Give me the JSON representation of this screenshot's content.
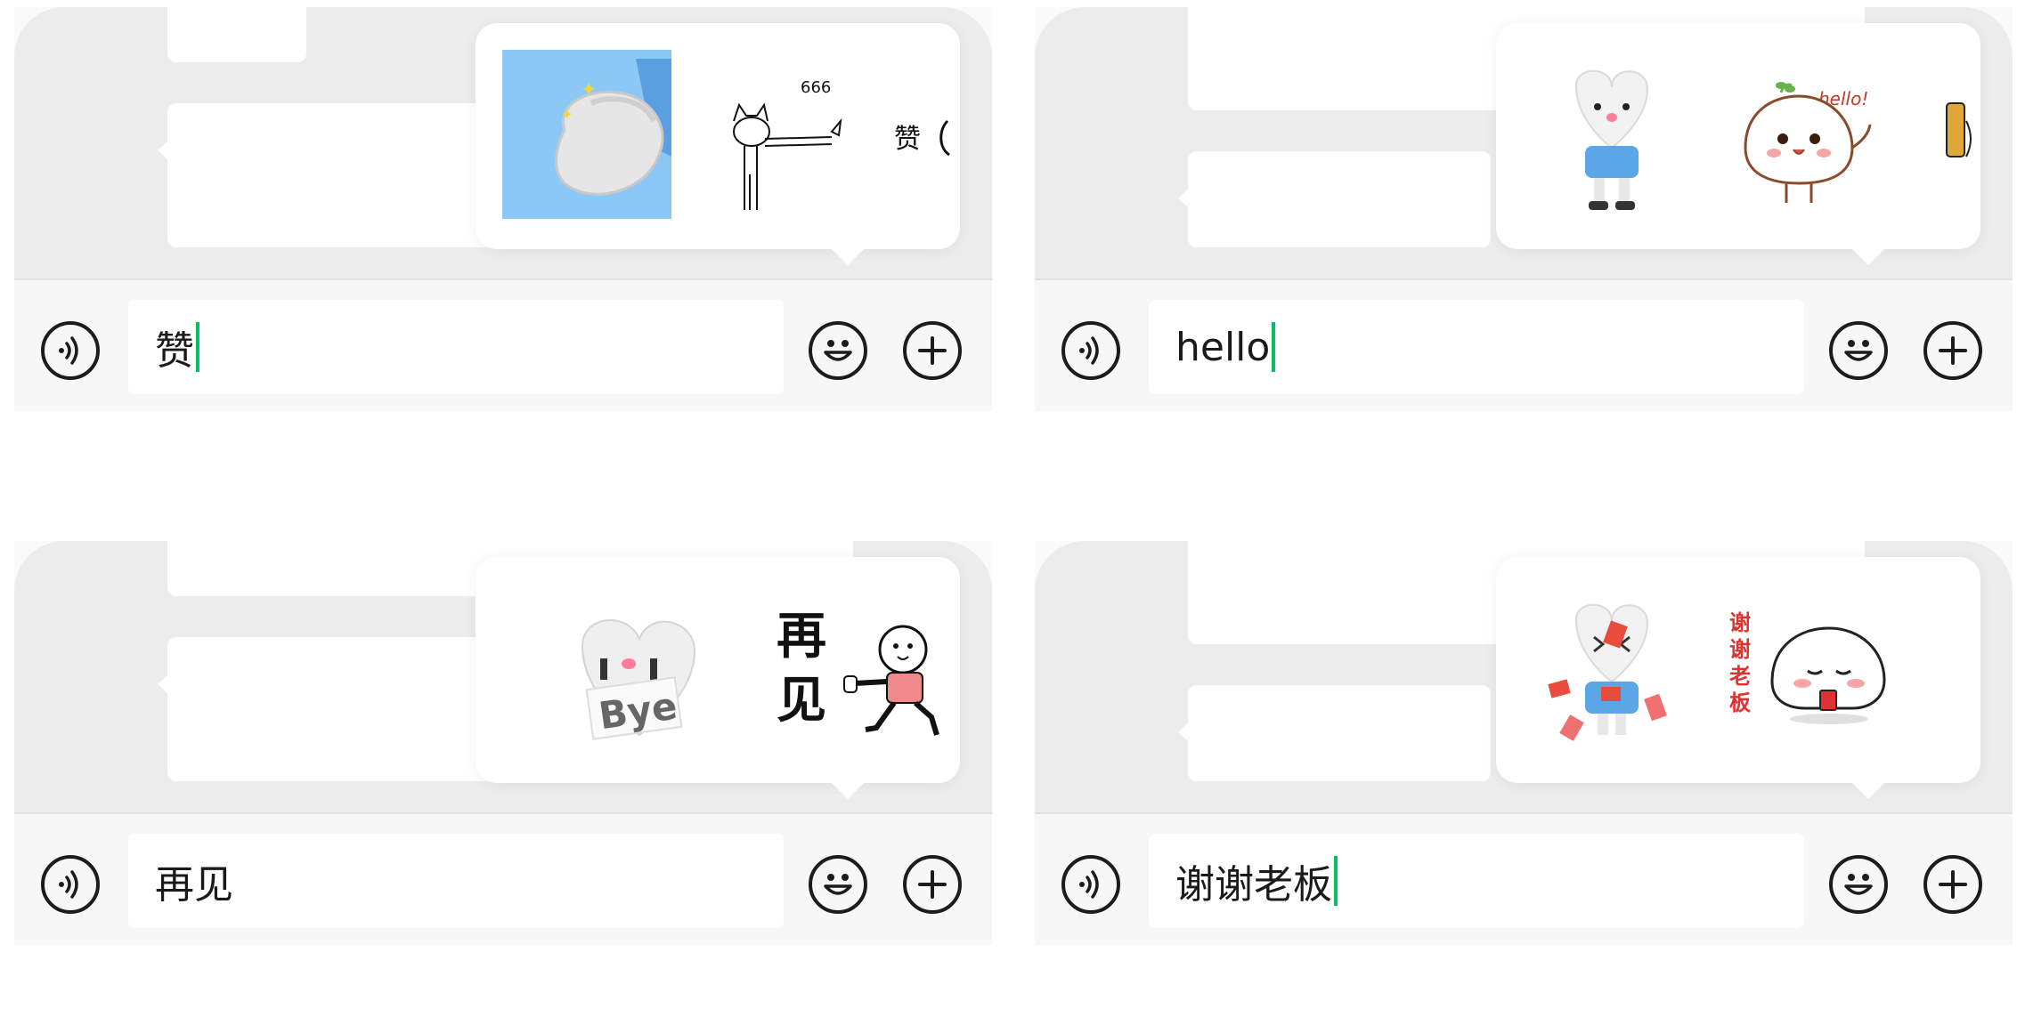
{
  "panels": [
    {
      "id": "top-left",
      "input_text": "赞",
      "show_caret": true,
      "stickers": [
        {
          "kind": "arm-flex",
          "icon": "flexed-arm-sticker"
        },
        {
          "kind": "cat-thumbs-666",
          "icon": "cat-thumb-sticker",
          "text": "666"
        },
        {
          "kind": "partial-zan",
          "icon": "zan-sticker-partial",
          "text": "赞"
        }
      ]
    },
    {
      "id": "top-right",
      "input_text": "hello",
      "show_caret": true,
      "stickers": [
        {
          "kind": "heart-doll-wave",
          "icon": "heart-doll-sticker"
        },
        {
          "kind": "bun-hello",
          "icon": "bun-hello-sticker",
          "text": "hello!"
        },
        {
          "kind": "partial-phone",
          "icon": "phone-sticker-partial"
        }
      ]
    },
    {
      "id": "bottom-left",
      "input_text": "再见",
      "show_caret": false,
      "stickers": [
        {
          "kind": "heart-bye",
          "icon": "heart-bye-sticker",
          "text": "Bye"
        },
        {
          "kind": "kneel-bye",
          "icon": "kneeling-man-sticker",
          "text1": "再",
          "text2": "见"
        }
      ]
    },
    {
      "id": "bottom-right",
      "input_text": "谢谢老板",
      "show_caret": true,
      "stickers": [
        {
          "kind": "heart-redpacket",
          "icon": "heart-redpacket-sticker"
        },
        {
          "kind": "bun-thanks-boss",
          "icon": "bun-thanks-sticker",
          "text": "谢谢老板"
        }
      ]
    }
  ],
  "colors": {
    "caret": "#07c160",
    "chat_bg": "#ececec",
    "input_bar_bg": "#f7f7f7"
  }
}
